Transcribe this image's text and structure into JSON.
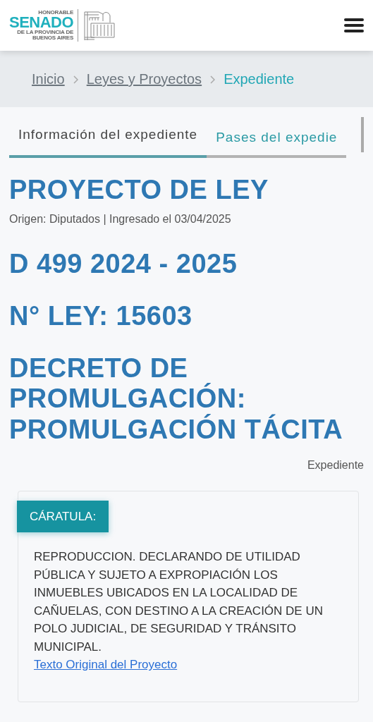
{
  "logo": {
    "lines": [
      "HONORABLE",
      "SENADO",
      "DE LA PROVINCIA DE",
      "BUENOS AIRES"
    ]
  },
  "breadcrumb": [
    {
      "label": "Inicio",
      "current": false
    },
    {
      "label": "Leyes y Proyectos",
      "current": false
    },
    {
      "label": "Expediente",
      "current": true
    }
  ],
  "tabs": [
    {
      "label": "Información del expediente",
      "selected": true
    },
    {
      "label": "Pases del expedie",
      "selected": false
    }
  ],
  "title": "PROYECTO DE LEY",
  "meta": "Origen: Diputados | Ingresado el 03/04/2025",
  "headings": [
    "D 499 2024 - 2025",
    "N° LEY: 15603",
    "DECRETO DE PROMULGACIÓN: PROMULGACIÓN TÁCITA"
  ],
  "section_label": "Expediente",
  "caratula": {
    "label": "CÁRATULA:",
    "text": "REPRODUCCION. DECLARANDO DE UTILIDAD PÚBLICA Y SUJETO A EXPROPIACIÓN LOS INMUEBLES UBICADOS EN LA LOCALIDAD DE CAÑUELAS, CON DESTINO A LA CREACIÓN DE UN POLO JUDICIAL, DE SEGURIDAD Y TRÁNSITO MUNICIPAL.",
    "link": "Texto Original del Proyecto"
  }
}
